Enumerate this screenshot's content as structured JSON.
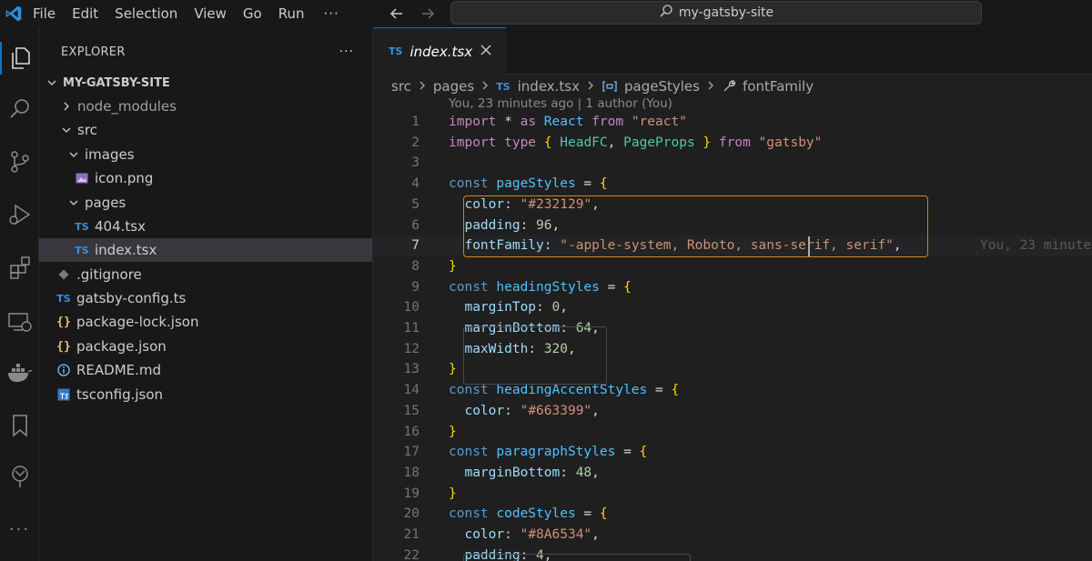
{
  "titlebar": {
    "menus": [
      "File",
      "Edit",
      "Selection",
      "View",
      "Go",
      "Run"
    ],
    "more": "···",
    "search": "my-gatsby-site"
  },
  "colors": {
    "accent": "#0078d4",
    "background": "#1f1f1f",
    "highlight_border": "#d18616"
  },
  "activity_icons": [
    "explorer-icon",
    "search-icon",
    "source-control-icon",
    "run-debug-icon",
    "extensions-icon",
    "remote-explorer-icon",
    "docker-icon",
    "bookmark-icon",
    "gitlens-icon",
    "more-icon"
  ],
  "sidebar": {
    "title": "EXPLORER",
    "more": "···",
    "root": "MY-GATSBY-SITE",
    "items": [
      {
        "label": "node_modules"
      },
      {
        "label": "src"
      },
      {
        "label": "images"
      },
      {
        "label": "icon.png"
      },
      {
        "label": "pages"
      },
      {
        "label": "404.tsx",
        "badge": "TS"
      },
      {
        "label": "index.tsx",
        "badge": "TS"
      },
      {
        "label": ".gitignore"
      },
      {
        "label": "gatsby-config.ts",
        "badge": "TS"
      },
      {
        "label": "package-lock.json",
        "badge": "{}"
      },
      {
        "label": "package.json",
        "badge": "{}"
      },
      {
        "label": "README.md"
      },
      {
        "label": "tsconfig.json"
      }
    ]
  },
  "editor": {
    "tab": {
      "badge": "TS",
      "label": "index.tsx"
    },
    "breadcrumb": [
      "src",
      "pages",
      "index.tsx",
      "pageStyles",
      "fontFamily"
    ],
    "breadcrumb_badge": "TS",
    "blame": "You, 23 minutes ago | 1 author (You)",
    "ghost": "You, 23 minute",
    "line_numbers": [
      "1",
      "2",
      "3",
      "4",
      "5",
      "6",
      "7",
      "8",
      "9",
      "10",
      "11",
      "12",
      "13",
      "14",
      "15",
      "16",
      "17",
      "18",
      "19",
      "20",
      "21",
      "22"
    ],
    "code": {
      "l1": [
        "import",
        " * ",
        "as",
        " React ",
        "from",
        " \"react\""
      ],
      "l2": [
        "import",
        " type ",
        "{ ",
        "HeadFC",
        ", ",
        "PageProps",
        " } ",
        "from",
        " \"gatsby\""
      ],
      "l4": [
        "const",
        " pageStyles ",
        "=",
        " {"
      ],
      "l5": [
        "color",
        ": ",
        "\"#232129\"",
        ","
      ],
      "l6": [
        "padding",
        ": ",
        "96",
        ","
      ],
      "l7": [
        "fontFamily",
        ": ",
        "\"-apple-system, Roboto, sans-serif, serif\"",
        ","
      ],
      "l8": [
        "}"
      ],
      "l9": [
        "const",
        " headingStyles ",
        "=",
        " {"
      ],
      "l10": [
        "marginTop",
        ": ",
        "0",
        ","
      ],
      "l11": [
        "marginBottom",
        ": ",
        "64",
        ","
      ],
      "l12": [
        "maxWidth",
        ": ",
        "320",
        ","
      ],
      "l13": [
        "}"
      ],
      "l14": [
        "const",
        " headingAccentStyles ",
        "=",
        " {"
      ],
      "l15": [
        "color",
        ": ",
        "\"#663399\"",
        ","
      ],
      "l16": [
        "}"
      ],
      "l17": [
        "const",
        " paragraphStyles ",
        "=",
        " {"
      ],
      "l18": [
        "marginBottom",
        ": ",
        "48",
        ","
      ],
      "l19": [
        "}"
      ],
      "l20": [
        "const",
        " codeStyles ",
        "=",
        " {"
      ],
      "l21": [
        "color",
        ": ",
        "\"#8A6534\"",
        ","
      ],
      "l22": [
        "padding",
        ": ",
        "4",
        ","
      ]
    }
  }
}
